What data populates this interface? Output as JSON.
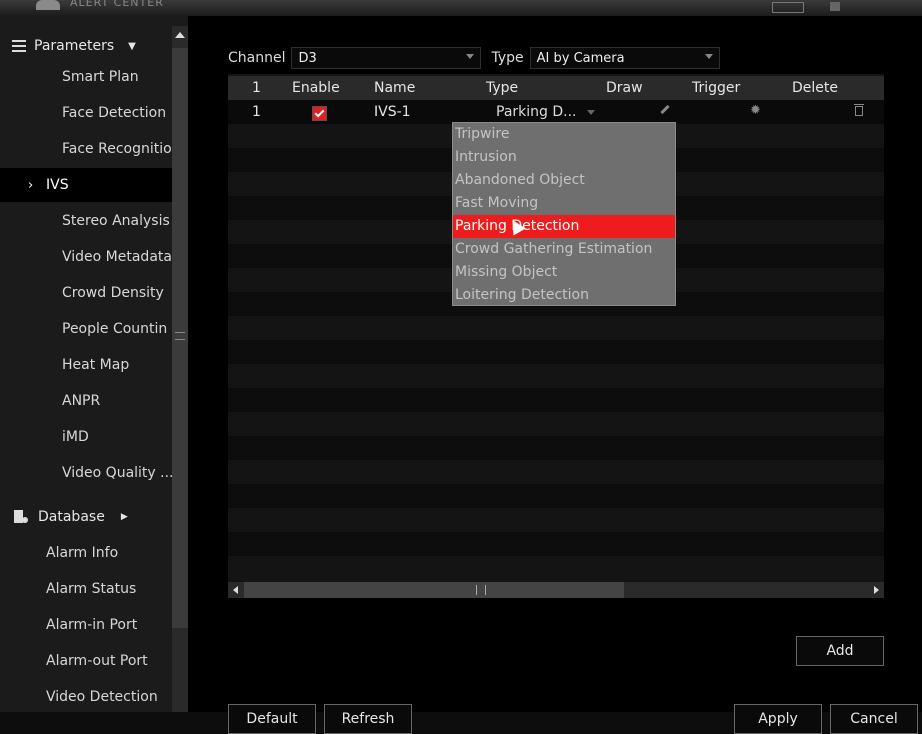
{
  "header": {
    "title": "ALERT CENTER"
  },
  "sidebar": {
    "section": "Parameters",
    "items": [
      {
        "label": "Smart Plan"
      },
      {
        "label": "Face Detection"
      },
      {
        "label": "Face Recognitio"
      },
      {
        "label": "IVS"
      },
      {
        "label": "Stereo Analysis"
      },
      {
        "label": "Video Metadata"
      },
      {
        "label": "Crowd Density"
      },
      {
        "label": "People Countin"
      },
      {
        "label": "Heat Map"
      },
      {
        "label": "ANPR"
      },
      {
        "label": "iMD"
      },
      {
        "label": "Video Quality ..."
      }
    ],
    "database": "Database",
    "bottom_items": [
      {
        "label": "Alarm Info"
      },
      {
        "label": "Alarm Status"
      },
      {
        "label": "Alarm-in Port"
      },
      {
        "label": "Alarm-out Port"
      },
      {
        "label": "Video Detection"
      }
    ],
    "active_item": "IVS"
  },
  "filters": {
    "channel_label": "Channel",
    "channel_value": "D3",
    "type_label": "Type",
    "type_value": "AI by Camera"
  },
  "table": {
    "columns": [
      "1",
      "Enable",
      "Name",
      "Type",
      "Draw",
      "Trigger",
      "Delete"
    ],
    "rows": [
      {
        "index": "1",
        "enabled": true,
        "name": "IVS-1",
        "type": "Parking D..."
      }
    ]
  },
  "type_dropdown": {
    "options": [
      "Tripwire",
      "Intrusion",
      "Abandoned Object",
      "Fast Moving",
      "Parking Detection",
      "Crowd Gathering Estimation",
      "Missing Object",
      "Loitering Detection"
    ],
    "selected": "Parking Detection"
  },
  "buttons": {
    "add": "Add",
    "default": "Default",
    "refresh": "Refresh",
    "apply": "Apply",
    "cancel": "Cancel"
  },
  "colors": {
    "accent": "#ee1c1c",
    "background": "#000000",
    "sidebar": "#1b1b1b"
  }
}
